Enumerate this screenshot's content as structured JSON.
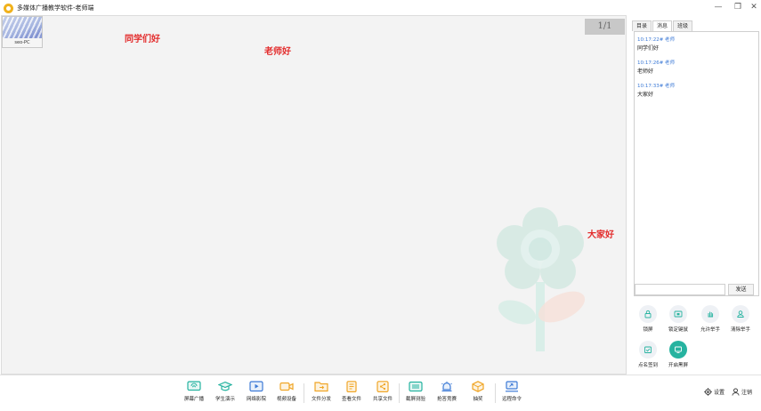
{
  "app": {
    "title": "多媒体广播教学软件-老师端"
  },
  "canvas": {
    "thumbnail_label": "seo-PC",
    "page_indicator": "1/1",
    "annotations": [
      "同学们好",
      "老师好",
      "大家好"
    ]
  },
  "panel": {
    "tabs": [
      "目录",
      "消息",
      "班级"
    ],
    "active_tab": "消息",
    "messages": [
      {
        "header": "10:17:22# 老师",
        "text": "同学们好"
      },
      {
        "header": "10:17:26# 老师",
        "text": "老师好"
      },
      {
        "header": "10:17:33# 老师",
        "text": "大家好"
      }
    ],
    "input_value": "",
    "send_label": "发送",
    "controls": [
      {
        "label": "锁屏",
        "icon": "lock-screen-icon"
      },
      {
        "label": "锁定键鼠",
        "icon": "keyboard-lock-icon"
      },
      {
        "label": "允许举手",
        "icon": "raise-hand-icon"
      },
      {
        "label": "清除举手",
        "icon": "clear-hand-icon"
      },
      {
        "label": "点名签到",
        "icon": "roll-call-icon"
      },
      {
        "label": "开启黑屏",
        "icon": "black-screen-icon"
      }
    ]
  },
  "toolbar": {
    "items": [
      {
        "label": "屏幕广播",
        "icon": "broadcast-icon"
      },
      {
        "label": "学生演示",
        "icon": "student-demo-icon"
      },
      {
        "label": "网络影院",
        "icon": "network-cinema-icon"
      },
      {
        "label": "视频设备",
        "icon": "video-device-icon"
      },
      {
        "label": "文件分发",
        "icon": "file-distribute-icon"
      },
      {
        "label": "查看文件",
        "icon": "view-file-icon"
      },
      {
        "label": "共享文件",
        "icon": "share-file-icon"
      },
      {
        "label": "截屏测验",
        "icon": "screenshot-quiz-icon"
      },
      {
        "label": "抢答竞赛",
        "icon": "quick-answer-icon"
      },
      {
        "label": "抽奖",
        "icon": "lottery-icon"
      },
      {
        "label": "远程命令",
        "icon": "remote-command-icon"
      }
    ],
    "settings_label": "设置",
    "logout_label": "注销"
  },
  "colors": {
    "accent": "#26b3a0",
    "annotation": "#e32b2b",
    "message_header": "#3d7ad6",
    "page_indicator_bg": "#c8c8c8"
  }
}
